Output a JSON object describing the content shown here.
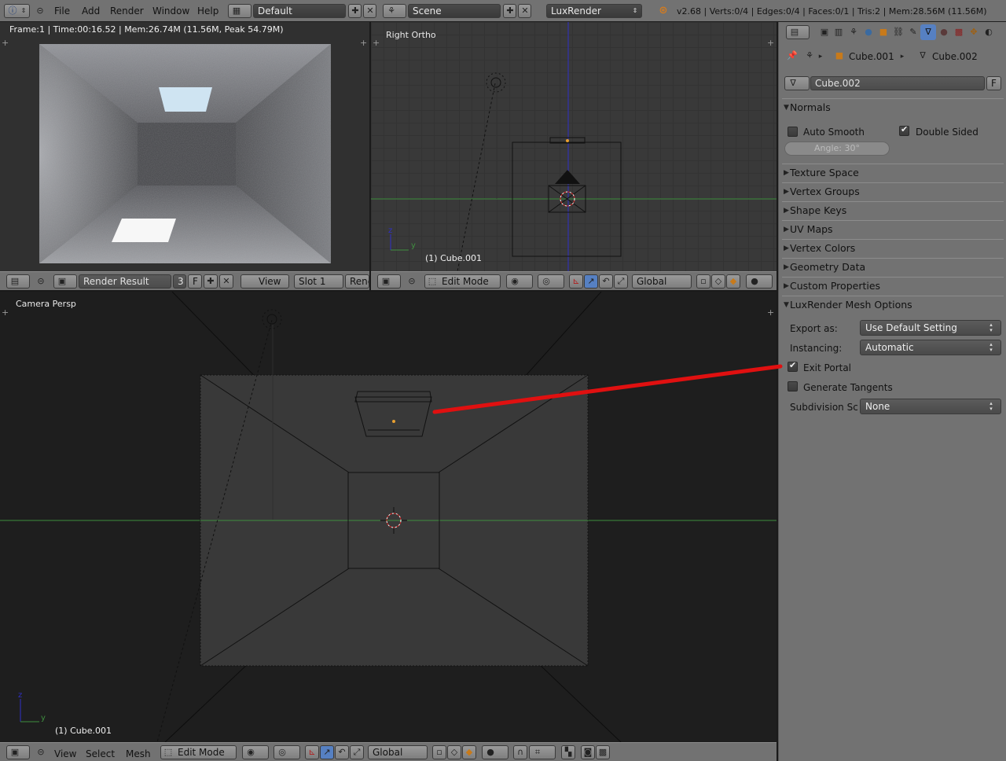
{
  "top_bar": {
    "menus": [
      "File",
      "Add",
      "Render",
      "Window",
      "Help"
    ],
    "screen_layout": "Default",
    "scene": "Scene",
    "render_engine": "LuxRender",
    "stats": "v2.68 | Verts:0/4 | Edges:0/4 | Faces:0/1 | Tris:2 | Mem:28.56M (11.56M)"
  },
  "image_editor": {
    "info": "Frame:1 | Time:00:16.52 | Mem:26.74M (11.56M, Peak 54.79M)",
    "image_name": "Render Result",
    "users": "3",
    "fake_user": "F",
    "view_menu": "View",
    "slot": "Slot 1",
    "render_layer": "Renc"
  },
  "right_ortho": {
    "title": "Right Ortho",
    "object_label": "(1) Cube.001",
    "mode": "Edit Mode",
    "orientation": "Global"
  },
  "camera_view": {
    "title": "Camera Persp",
    "object_label": "(1) Cube.001",
    "menus": [
      "View",
      "Select",
      "Mesh"
    ],
    "mode": "Edit Mode",
    "orientation": "Global"
  },
  "properties": {
    "breadcrumb": [
      "Cube.001",
      "Cube.002"
    ],
    "mesh_name": "Cube.002",
    "fake_user": "F",
    "normals": {
      "title": "Normals",
      "auto_smooth": "Auto Smooth",
      "auto_smooth_checked": false,
      "double_sided": "Double Sided",
      "double_sided_checked": true,
      "angle": "Angle: 30°"
    },
    "collapsed_panels": [
      "Texture Space",
      "Vertex Groups",
      "Shape Keys",
      "UV Maps",
      "Vertex Colors",
      "Geometry Data",
      "Custom Properties"
    ],
    "luxrender": {
      "title": "LuxRender Mesh Options",
      "export_as_label": "Export as:",
      "export_as_value": "Use Default Setting",
      "instancing_label": "Instancing:",
      "instancing_value": "Automatic",
      "exit_portal": "Exit Portal",
      "exit_portal_checked": true,
      "generate_tangents": "Generate Tangents",
      "generate_tangents_checked": false,
      "subdivision_label": "Subdivision Sc",
      "subdivision_value": "None"
    }
  },
  "colors": {
    "annotation_arrow": "#e01010",
    "axis_x_line": "#3f8f3f",
    "axis_z_line": "#3030c8",
    "selected_header_icon": "#5680c2"
  }
}
